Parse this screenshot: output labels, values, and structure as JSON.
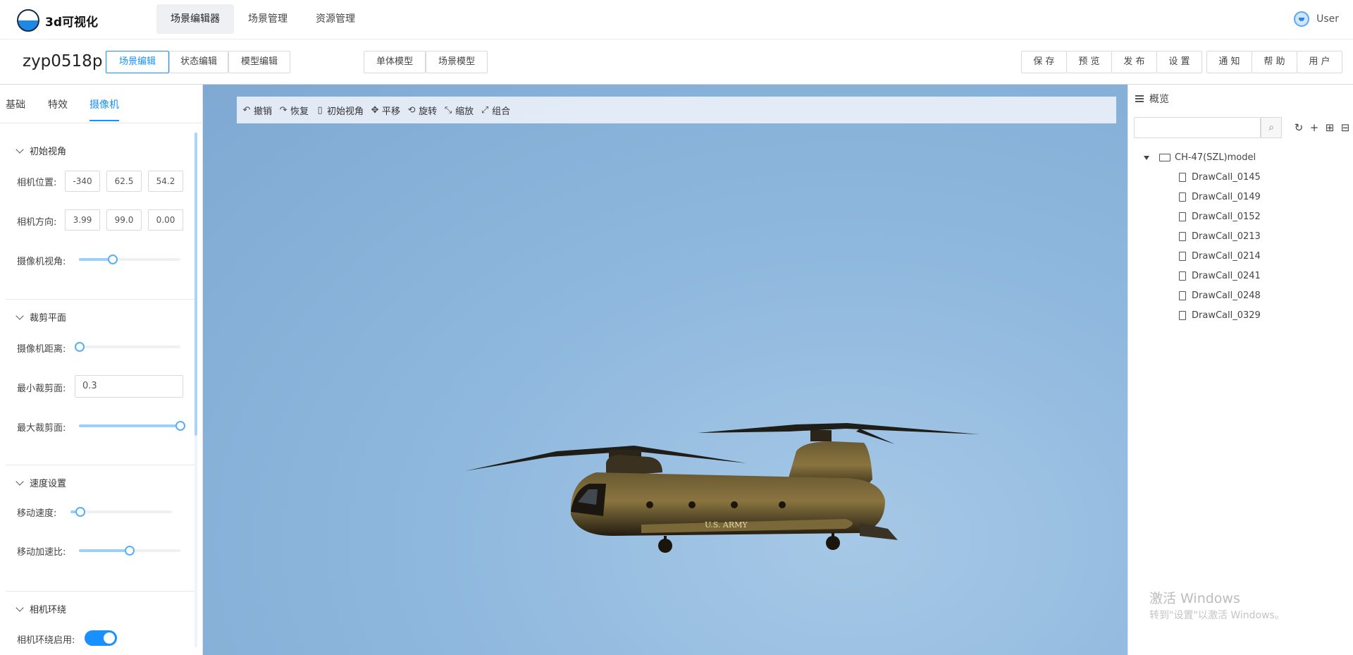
{
  "app": {
    "name": "3d可视化"
  },
  "topnav": {
    "tabs": [
      "场景编辑器",
      "场景管理",
      "资源管理"
    ],
    "user": "User"
  },
  "toolbar": {
    "project": "zyp0518p",
    "modes": [
      "场景编辑",
      "状态编辑",
      "模型编辑"
    ],
    "model_types": [
      "单体模型",
      "场景模型"
    ],
    "actions": [
      "保 存",
      "预 览",
      "发 布",
      "设 置"
    ],
    "misc": [
      "通 知",
      "帮 助",
      "用 户"
    ]
  },
  "left": {
    "tabs": [
      "基础",
      "特效",
      "摄像机"
    ],
    "initial_view": {
      "title": "初始视角",
      "position_label": "相机位置:",
      "position": [
        "-340",
        "62.5",
        "54.2"
      ],
      "direction_label": "相机方向:",
      "direction": [
        "3.99",
        "99.0",
        "0.00"
      ],
      "fov_label": "摄像机视角:",
      "fov_value": 0.33
    },
    "clip": {
      "title": "裁剪平面",
      "distance_label": "摄像机距离:",
      "distance_value": 0.01,
      "min_label": "最小裁剪面:",
      "min_value": "0.3",
      "max_label": "最大裁剪面:",
      "max_value": 1.0
    },
    "speed": {
      "title": "速度设置",
      "move_label": "移动速度:",
      "move_value": 0.1,
      "accel_label": "移动加速比:",
      "accel_value": 0.5
    },
    "orbit": {
      "title": "相机环绕",
      "enable_label": "相机环绕启用:",
      "enabled": true
    }
  },
  "viewport": {
    "tools": [
      {
        "icon": "undo-icon",
        "glyph": "↶",
        "label": "撤销"
      },
      {
        "icon": "redo-icon",
        "glyph": "↷",
        "label": "恢复"
      },
      {
        "icon": "initial-view-icon",
        "glyph": "▯",
        "label": "初始视角"
      },
      {
        "icon": "pan-icon",
        "glyph": "✥",
        "label": "平移"
      },
      {
        "icon": "rotate-icon",
        "glyph": "⟲",
        "label": "旋转"
      },
      {
        "icon": "scale-icon",
        "glyph": "⤡",
        "label": "缩放"
      },
      {
        "icon": "group-icon",
        "glyph": "⤢",
        "label": "组合"
      }
    ],
    "model_text": "U.S. ARMY"
  },
  "right": {
    "title": "概览",
    "root": "CH-47(SZL)model",
    "items": [
      "DrawCall_0145",
      "DrawCall_0149",
      "DrawCall_0152",
      "DrawCall_0213",
      "DrawCall_0214",
      "DrawCall_0241",
      "DrawCall_0248",
      "DrawCall_0329"
    ]
  },
  "watermark": {
    "line1": "激活 Windows",
    "line2": "转到\"设置\"以激活 Windows。"
  },
  "colors": {
    "accent": "#1890ff",
    "sky": "#8fb8de"
  }
}
